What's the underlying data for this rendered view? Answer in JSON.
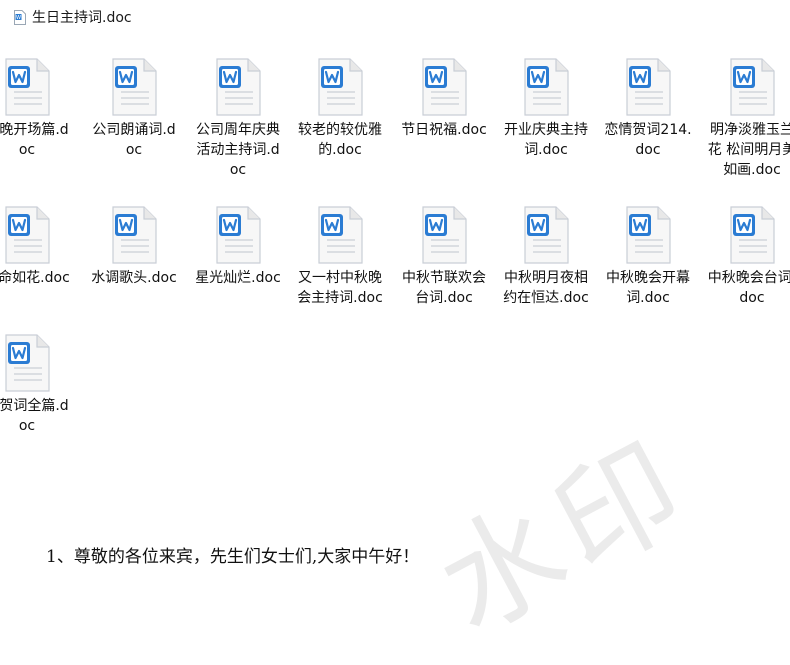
{
  "title": "生日主持词.doc",
  "files": [
    {
      "label": "春晚开场篇.doc"
    },
    {
      "label": "公司朗诵词.doc"
    },
    {
      "label": "公司周年庆典活动主持词.doc"
    },
    {
      "label": "较老的较优雅的.doc"
    },
    {
      "label": "节日祝福.doc"
    },
    {
      "label": "开业庆典主持词.doc"
    },
    {
      "label": "恋情贺词214.doc"
    },
    {
      "label": "明净淡雅玉兰花 松间明月美如画.doc"
    },
    {
      "label": "生命如花.doc"
    },
    {
      "label": "水调歌头.doc"
    },
    {
      "label": "星光灿烂.doc"
    },
    {
      "label": "又一村中秋晚会主持词.doc"
    },
    {
      "label": "中秋节联欢会台词.doc"
    },
    {
      "label": "中秋明月夜相约在恒达.doc"
    },
    {
      "label": "中秋晚会开幕词.doc"
    },
    {
      "label": "中秋晚会台词.doc"
    },
    {
      "label": "祝贺词全篇.doc"
    }
  ],
  "watermark": "水印",
  "document": {
    "heading": "1、尊敬的各位来宾，先生们女士们,大家中午好！"
  },
  "colors": {
    "icon_blue": "#2b7cd3",
    "icon_page": "#f5f5f5"
  }
}
